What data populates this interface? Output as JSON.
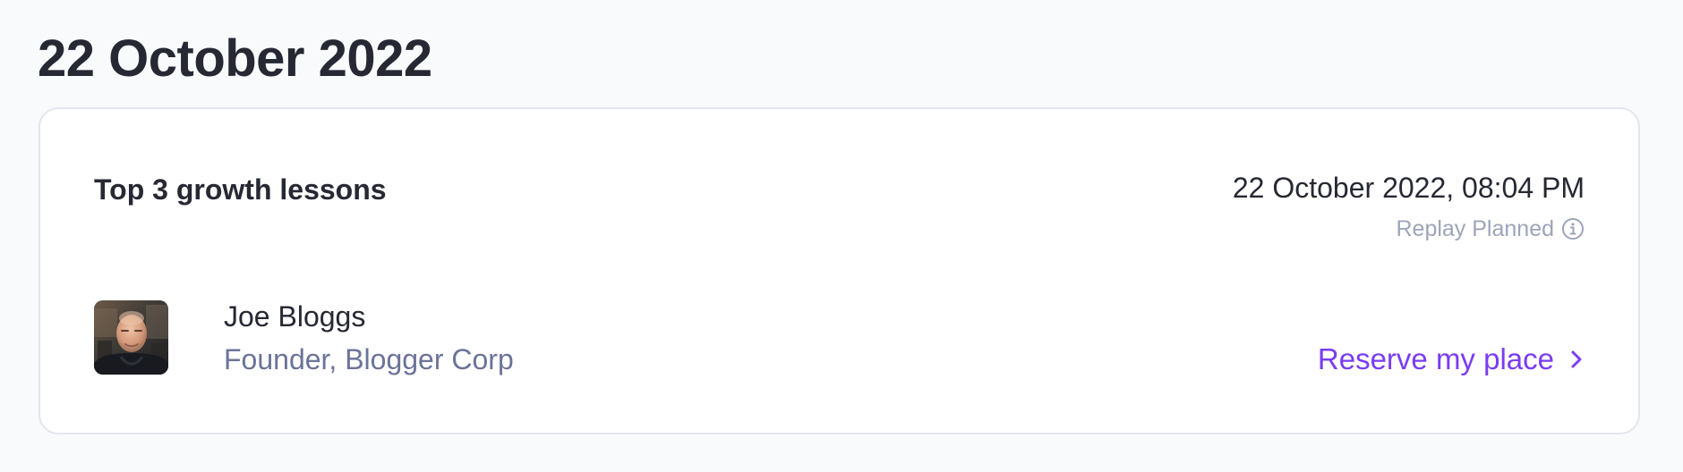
{
  "page": {
    "title": "22 October 2022"
  },
  "event": {
    "title": "Top 3 growth lessons",
    "datetime": "22 October 2022, 08:04 PM",
    "replay_status": "Replay Planned",
    "replay_icon": "info-icon",
    "speaker": {
      "name": "Joe Bloggs",
      "role": "Founder, Blogger Corp",
      "avatar": "speaker-photo"
    },
    "cta": {
      "label": "Reserve my place",
      "icon": "chevron-right-icon"
    }
  },
  "colors": {
    "background": "#f9fafc",
    "card": "#ffffff",
    "card_border": "#e3e6ee",
    "text_primary": "#262833",
    "text_secondary": "#6b7399",
    "text_muted": "#9ea4b8",
    "accent": "#7b3cf2"
  }
}
